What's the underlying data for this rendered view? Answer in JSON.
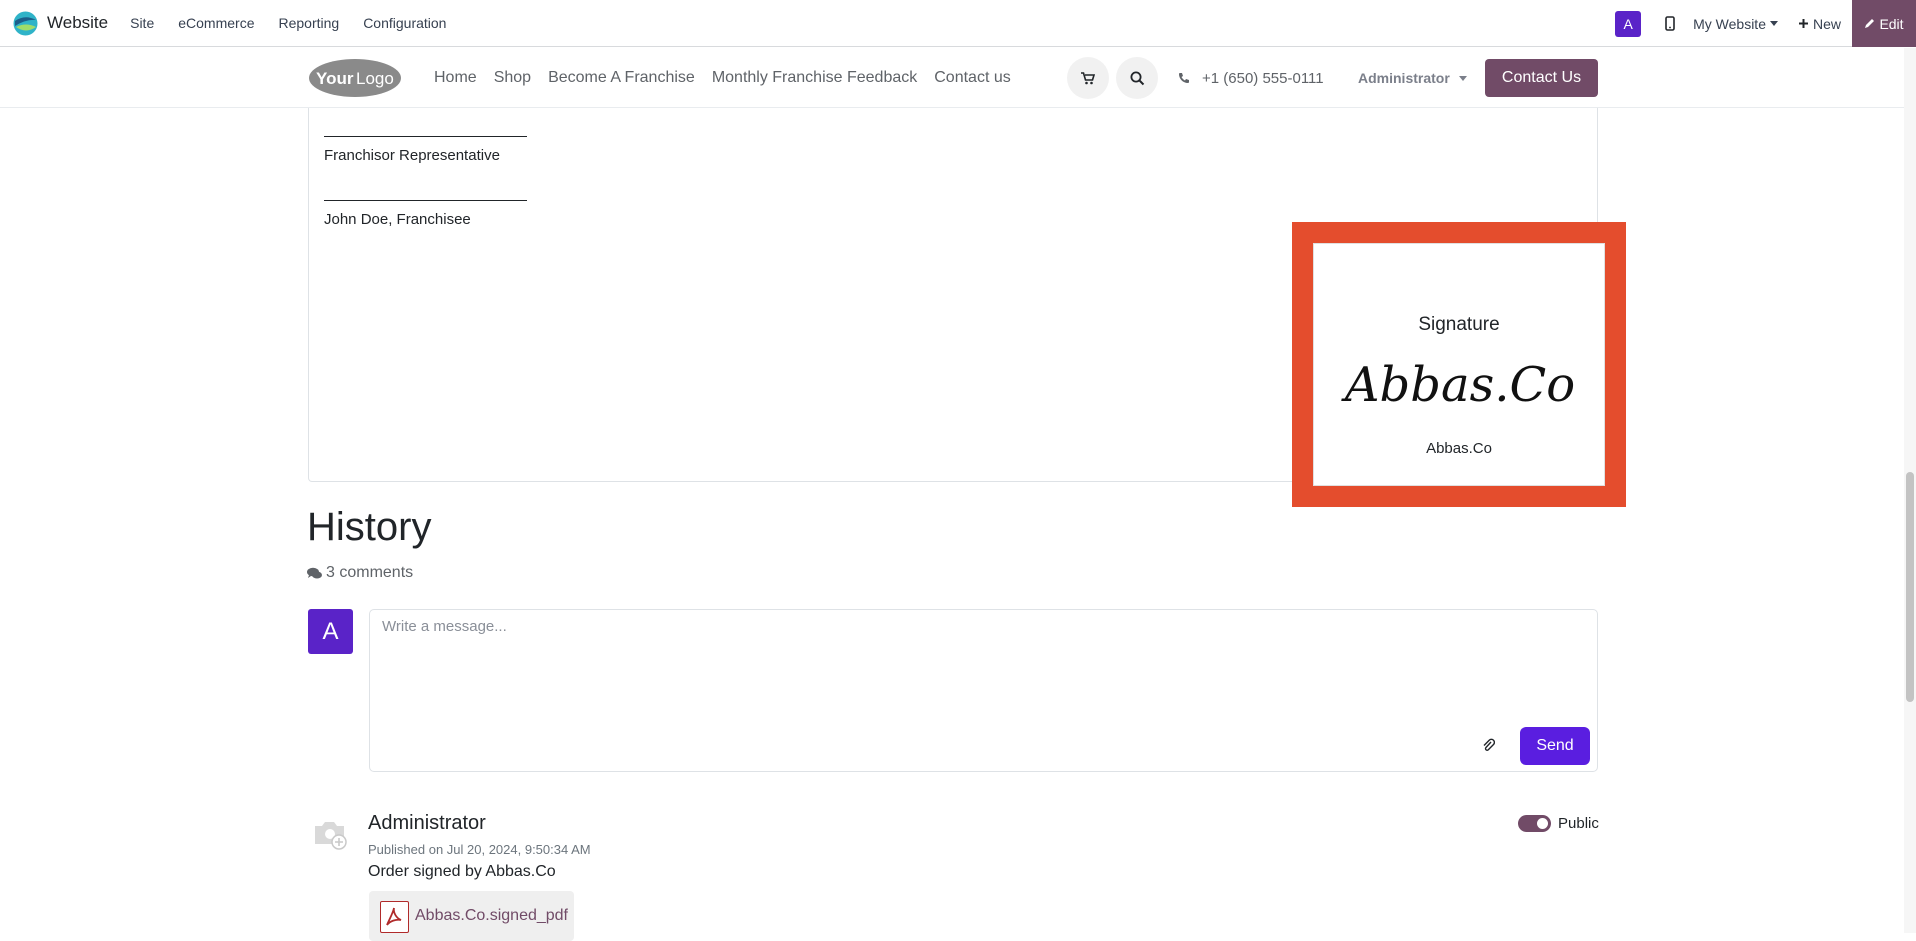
{
  "topbar": {
    "app_name": "Website",
    "menu": [
      "Site",
      "eCommerce",
      "Reporting",
      "Configuration"
    ],
    "avatar_letter": "A",
    "my_website": "My Website",
    "new_label": "New",
    "edit_label": "Edit"
  },
  "site_header": {
    "nav": [
      "Home",
      "Shop",
      "Become A Franchise",
      "Monthly Franchise Feedback",
      "Contact us"
    ],
    "phone": "+1 (650) 555-0111",
    "user": "Administrator",
    "contact_button": "Contact Us",
    "logo_text": "YourLogo"
  },
  "document": {
    "line1_label": "Franchisor Representative",
    "line2_label": "John Doe, Franchisee",
    "signature": {
      "heading": "Signature",
      "script": "Abbas.Co",
      "name": "Abbas.Co"
    }
  },
  "history": {
    "title": "History",
    "comment_count": "3 comments",
    "avatar_letter": "A",
    "composer_placeholder": "Write a message...",
    "send_label": "Send",
    "messages": [
      {
        "author": "Administrator",
        "published": "Published on Jul 20, 2024, 9:50:34 AM",
        "body": "Order signed by Abbas.Co",
        "attachment": "Abbas.Co.signed_pdf",
        "visibility": "Public"
      }
    ]
  },
  "colors": {
    "brand": "#714b67",
    "avatar": "#5a23c8",
    "highlight": "#e44d2d",
    "send": "#5a1ee0"
  }
}
